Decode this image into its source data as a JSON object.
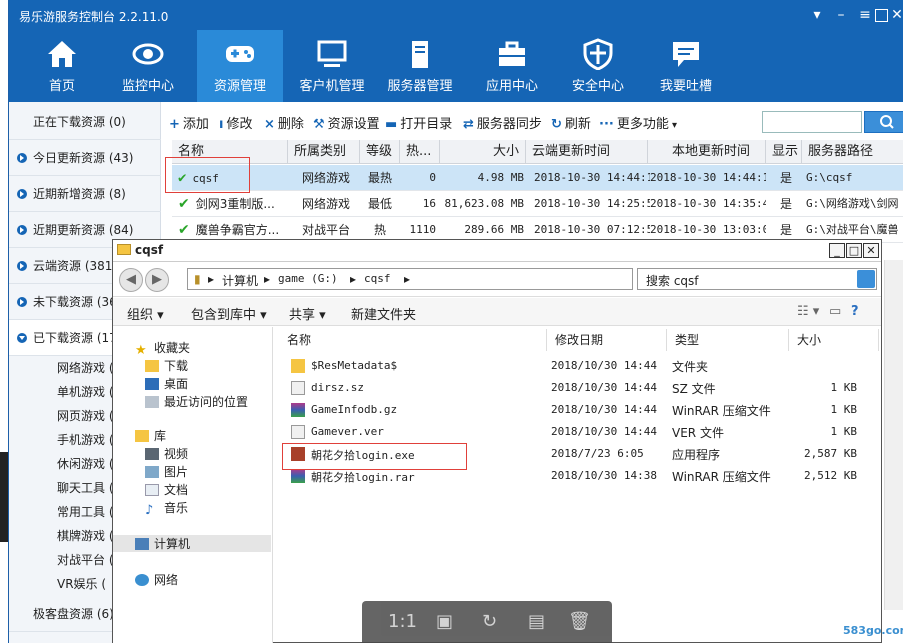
{
  "window": {
    "title": "易乐游服务控制台 2.2.11.0"
  },
  "nav": [
    {
      "label": "首页",
      "icon": "home-icon"
    },
    {
      "label": "监控中心",
      "icon": "eye-icon"
    },
    {
      "label": "资源管理",
      "icon": "gamepad-icon",
      "active": true
    },
    {
      "label": "客户机管理",
      "icon": "monitor-icon"
    },
    {
      "label": "服务器管理",
      "icon": "server-icon"
    },
    {
      "label": "应用中心",
      "icon": "toolbox-icon"
    },
    {
      "label": "安全中心",
      "icon": "shield-icon"
    },
    {
      "label": "我要吐槽",
      "icon": "chat-icon"
    }
  ],
  "side": {
    "items": [
      {
        "label": "正在下载资源 (0)"
      },
      {
        "label": "今日更新资源 (43)"
      },
      {
        "label": "近期新增资源 (8)"
      },
      {
        "label": "近期更新资源 (84)"
      },
      {
        "label": "云端资源 (3811"
      },
      {
        "label": "未下载资源 (36"
      },
      {
        "label": "已下载资源 (17"
      }
    ],
    "sub": [
      "网络游戏 (",
      "单机游戏 (",
      "网页游戏 (",
      "手机游戏 (",
      "休闲游戏 (",
      "聊天工具 (",
      "常用工具 (",
      "棋牌游戏 (",
      "对战平台 (",
      "VR娱乐 ("
    ],
    "last": "极客盘资源 (6)"
  },
  "toolbar": {
    "add": "添加",
    "edit": "修改",
    "delete": "删除",
    "settings": "资源设置",
    "open_dir": "打开目录",
    "sync": "服务器同步",
    "refresh": "刷新",
    "more": "更多功能"
  },
  "table": {
    "headers": [
      "名称",
      "所属类别",
      "等级",
      "热...",
      "大小",
      "云端更新时间",
      "本地更新时间",
      "显示",
      "服务器路径"
    ],
    "rows": [
      {
        "name": "cqsf",
        "category": "网络游戏",
        "level": "最热",
        "hot": "0",
        "size": "4.98 MB",
        "cloud": "2018-10-30 14:44:11",
        "local": "2018-10-30 14:44:11",
        "show": "是",
        "path": "G:\\cqsf"
      },
      {
        "name": "剑网3重制版...",
        "category": "网络游戏",
        "level": "最低",
        "hot": "16",
        "size": "81,623.08 MB",
        "cloud": "2018-10-30 14:25:50",
        "local": "2018-10-30 14:35:46",
        "show": "是",
        "path": "G:\\网络游戏\\剑网"
      },
      {
        "name": "魔兽争霸官方...",
        "category": "对战平台",
        "level": "热",
        "hot": "1110",
        "size": "289.66 MB",
        "cloud": "2018-10-30 07:12:50",
        "local": "2018-10-30 13:03:02",
        "show": "是",
        "path": "G:\\对战平台\\魔兽"
      }
    ]
  },
  "explorer": {
    "title": "cqsf",
    "address": [
      "计算机",
      "game (G:)",
      "cqsf"
    ],
    "search_placeholder": "搜索 cqsf",
    "tools": [
      "组织",
      "包含到库中",
      "共享",
      "新建文件夹"
    ],
    "tree": [
      {
        "label": "收藏夹",
        "icon": "star-icon"
      },
      {
        "label": "下载",
        "icon": "download-folder-icon"
      },
      {
        "label": "桌面",
        "icon": "desktop-icon"
      },
      {
        "label": "最近访问的位置",
        "icon": "recent-icon"
      },
      {
        "label": "库",
        "icon": "library-icon"
      },
      {
        "label": "视频",
        "icon": "video-icon"
      },
      {
        "label": "图片",
        "icon": "picture-icon"
      },
      {
        "label": "文档",
        "icon": "document-icon"
      },
      {
        "label": "音乐",
        "icon": "music-icon"
      },
      {
        "label": "计算机",
        "icon": "computer-icon"
      },
      {
        "label": "网络",
        "icon": "network-icon"
      }
    ],
    "headers": [
      "名称",
      "修改日期",
      "类型",
      "大小"
    ],
    "files": [
      {
        "name": "$ResMetadata$",
        "date": "2018/10/30 14:44",
        "type": "文件夹",
        "size": "",
        "icon": "folder-icon"
      },
      {
        "name": "dirsz.sz",
        "date": "2018/10/30 14:44",
        "type": "SZ 文件",
        "size": "1 KB",
        "icon": "file-icon"
      },
      {
        "name": "GameInfodb.gz",
        "date": "2018/10/30 14:44",
        "type": "WinRAR 压缩文件",
        "size": "1 KB",
        "icon": "rar-icon"
      },
      {
        "name": "Gamever.ver",
        "date": "2018/10/30 14:44",
        "type": "VER 文件",
        "size": "1 KB",
        "icon": "file-icon"
      },
      {
        "name": "朝花夕拾login.exe",
        "date": "2018/7/23 6:05",
        "type": "应用程序",
        "size": "2,587 KB",
        "icon": "exe-icon"
      },
      {
        "name": "朝花夕拾login.rar",
        "date": "2018/10/30 14:38",
        "type": "WinRAR 压缩文件",
        "size": "2,512 KB",
        "icon": "rar-icon"
      }
    ]
  },
  "viewer": {
    "ratio": "1:1"
  },
  "watermark": "583go.com"
}
